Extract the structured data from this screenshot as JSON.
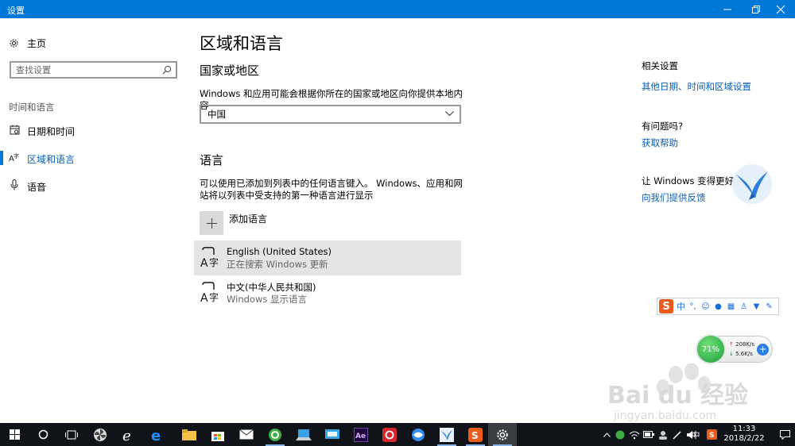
{
  "window": {
    "title": "设置"
  },
  "sidebar": {
    "home_label": "主页",
    "search_placeholder": "查找设置",
    "section_label": "时间和语言",
    "items": [
      {
        "label": "日期和时间",
        "icon": "calendar-icon"
      },
      {
        "label": "区域和语言",
        "icon": "region-icon",
        "active": true
      },
      {
        "label": "语音",
        "icon": "microphone-icon"
      }
    ]
  },
  "main": {
    "title": "区域和语言",
    "country_heading": "国家或地区",
    "country_desc": "Windows 和应用可能会根据你所在的国家或地区向你提供本地内容",
    "country_value": "中国",
    "language_heading": "语言",
    "language_desc": "可以使用已添加到列表中的任何语言键入。 Windows、应用和网站将以列表中受支持的第一种语言进行显示",
    "add_language_label": "添加语言",
    "languages": [
      {
        "name": "English (United States)",
        "status": "正在搜索 Windows 更新"
      },
      {
        "name": "中文(中华人民共和国)",
        "status": "Windows 显示语言"
      }
    ]
  },
  "right_panel": {
    "related_heading": "相关设置",
    "related_link": "其他日期、时间和区域设置",
    "help_heading": "有问题吗?",
    "help_link": "获取帮助",
    "feedback_heading": "让 Windows 变得更好。",
    "feedback_link": "向我们提供反馈"
  },
  "ime_bar": {
    "logo": "S",
    "mode": "中"
  },
  "network_widget": {
    "percent": "71%",
    "upload": "208K/s",
    "download": "5.6K/s"
  },
  "watermark": {
    "brand": "Bai du 经验",
    "url": "jingyan.baidu.com"
  },
  "taskbar": {
    "tray_input": "中",
    "time": "11:33",
    "date": "2018/2/22"
  },
  "colors": {
    "accent": "#0078d7",
    "link": "#0a5fb4",
    "taskbar": "#101418"
  }
}
